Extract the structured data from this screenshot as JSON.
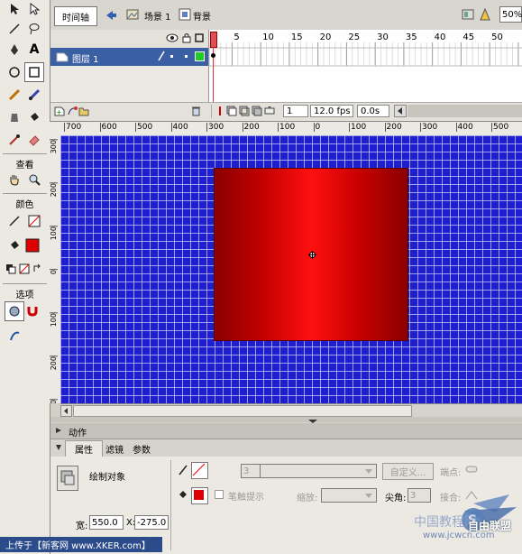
{
  "toolbox": {
    "section_view": "查看",
    "section_colors": "颜色",
    "section_options": "选项",
    "stroke_color": "#000000",
    "fill_color": "#dd0000"
  },
  "timeline": {
    "tab_label": "时间轴",
    "scene_label": "场景 1",
    "symbol_label": "背景",
    "zoom": "50%",
    "frame_numbers": [
      "1",
      "5",
      "10",
      "15",
      "20",
      "25",
      "30",
      "35",
      "40",
      "45",
      "50"
    ],
    "layer_name": "图层 1",
    "current_frame": "1",
    "fps": "12.0 fps",
    "elapsed": "0.0s"
  },
  "rulers": {
    "h_ticks": [
      "700",
      "600",
      "500",
      "400",
      "300",
      "200",
      "100",
      "0",
      "100",
      "200",
      "300",
      "400",
      "500",
      "600"
    ],
    "v_ticks": [
      "300",
      "200",
      "100",
      "0",
      "100",
      "200",
      "300"
    ]
  },
  "stage": {
    "background_color": "#1f1fd0",
    "shape_color_dark": "#8a0000",
    "shape_color_light": "#ff1010"
  },
  "panels": {
    "actions_label": "动作",
    "tab_properties": "属性",
    "tab_filters": "滤镜",
    "tab_parameters": "参数"
  },
  "properties": {
    "object_type": "绘制对象",
    "stroke_height": "3",
    "custom_button": "自定义...",
    "endpoint_label": "端点:",
    "hinting_label": "笔触提示",
    "scale_label": "缩放:",
    "miter_label": "尖角:",
    "miter_value": "3",
    "join_label": "接合:",
    "width_label": "宽:",
    "width_value": "550.0",
    "x_label": "X:",
    "x_value": "-275.0"
  },
  "footer": {
    "text": "上传于【新客网 www.XKER.com】"
  },
  "watermark": {
    "text": "中国教程网",
    "url": "www.jcwcn.com",
    "badge": "自由联盟"
  }
}
